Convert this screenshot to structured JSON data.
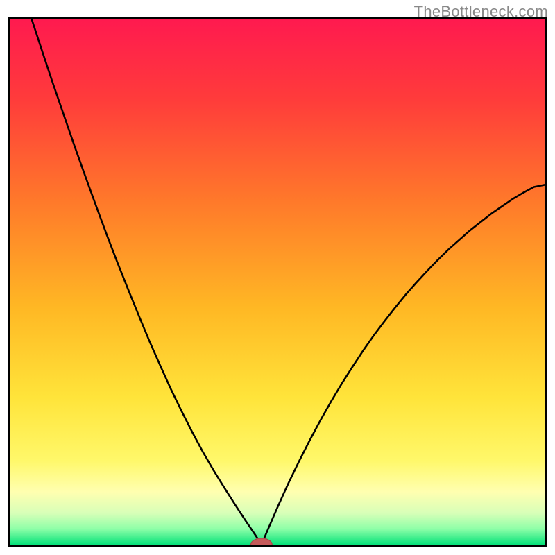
{
  "watermark": "TheBottleneck.com",
  "colors": {
    "frame": "#000000",
    "gradient_stops": [
      {
        "offset": 0.0,
        "color": "#ff1a4f"
      },
      {
        "offset": 0.15,
        "color": "#ff3b3b"
      },
      {
        "offset": 0.35,
        "color": "#ff7a2a"
      },
      {
        "offset": 0.55,
        "color": "#ffb824"
      },
      {
        "offset": 0.72,
        "color": "#ffe43a"
      },
      {
        "offset": 0.84,
        "color": "#fff86a"
      },
      {
        "offset": 0.9,
        "color": "#ffffb0"
      },
      {
        "offset": 0.94,
        "color": "#d8ffb8"
      },
      {
        "offset": 0.97,
        "color": "#8effa8"
      },
      {
        "offset": 1.0,
        "color": "#06e27a"
      }
    ],
    "curve": "#000000",
    "marker_fill": "#c55a5a",
    "marker_stroke": "#a64848"
  },
  "chart_data": {
    "type": "line",
    "title": "",
    "xlabel": "",
    "ylabel": "",
    "xlim": [
      0,
      100
    ],
    "ylim": [
      0,
      100
    ],
    "notch": {
      "x": 47,
      "y": 0
    },
    "marker": {
      "x": 47,
      "y": 0,
      "rx": 2.0,
      "ry": 1.2
    },
    "left_branch": {
      "x_range": [
        4,
        47
      ],
      "description": "monotone decreasing from y≈100 at x≈4 to y=0 at x=47; convex",
      "samples": [
        {
          "x": 4.0,
          "y": 100.0
        },
        {
          "x": 6.0,
          "y": 93.8
        },
        {
          "x": 8.0,
          "y": 87.7
        },
        {
          "x": 10.0,
          "y": 81.8
        },
        {
          "x": 12.0,
          "y": 75.9
        },
        {
          "x": 14.0,
          "y": 70.2
        },
        {
          "x": 16.0,
          "y": 64.6
        },
        {
          "x": 18.0,
          "y": 59.1
        },
        {
          "x": 20.0,
          "y": 53.8
        },
        {
          "x": 22.0,
          "y": 48.7
        },
        {
          "x": 24.0,
          "y": 43.7
        },
        {
          "x": 26.0,
          "y": 38.8
        },
        {
          "x": 28.0,
          "y": 34.2
        },
        {
          "x": 30.0,
          "y": 29.7
        },
        {
          "x": 32.0,
          "y": 25.5
        },
        {
          "x": 34.0,
          "y": 21.5
        },
        {
          "x": 36.0,
          "y": 17.7
        },
        {
          "x": 38.0,
          "y": 14.2
        },
        {
          "x": 40.0,
          "y": 10.9
        },
        {
          "x": 42.0,
          "y": 7.7
        },
        {
          "x": 44.0,
          "y": 4.6
        },
        {
          "x": 46.0,
          "y": 1.6
        },
        {
          "x": 47.0,
          "y": 0.0
        }
      ]
    },
    "right_branch": {
      "x_range": [
        47,
        100
      ],
      "description": "monotone increasing from y=0 at x=47 to y≈68 at x=100; concave",
      "samples": [
        {
          "x": 47.0,
          "y": 0.0
        },
        {
          "x": 48.0,
          "y": 2.4
        },
        {
          "x": 50.0,
          "y": 7.1
        },
        {
          "x": 52.0,
          "y": 11.6
        },
        {
          "x": 54.0,
          "y": 15.8
        },
        {
          "x": 56.0,
          "y": 19.8
        },
        {
          "x": 58.0,
          "y": 23.6
        },
        {
          "x": 60.0,
          "y": 27.2
        },
        {
          "x": 62.0,
          "y": 30.6
        },
        {
          "x": 64.0,
          "y": 33.8
        },
        {
          "x": 66.0,
          "y": 36.9
        },
        {
          "x": 68.0,
          "y": 39.8
        },
        {
          "x": 70.0,
          "y": 42.5
        },
        {
          "x": 72.0,
          "y": 45.1
        },
        {
          "x": 74.0,
          "y": 47.6
        },
        {
          "x": 76.0,
          "y": 49.9
        },
        {
          "x": 78.0,
          "y": 52.1
        },
        {
          "x": 80.0,
          "y": 54.2
        },
        {
          "x": 82.0,
          "y": 56.2
        },
        {
          "x": 84.0,
          "y": 58.0
        },
        {
          "x": 86.0,
          "y": 59.8
        },
        {
          "x": 88.0,
          "y": 61.4
        },
        {
          "x": 90.0,
          "y": 63.0
        },
        {
          "x": 92.0,
          "y": 64.4
        },
        {
          "x": 94.0,
          "y": 65.8
        },
        {
          "x": 96.0,
          "y": 67.0
        },
        {
          "x": 98.0,
          "y": 68.1
        },
        {
          "x": 100.0,
          "y": 68.5
        }
      ]
    }
  }
}
